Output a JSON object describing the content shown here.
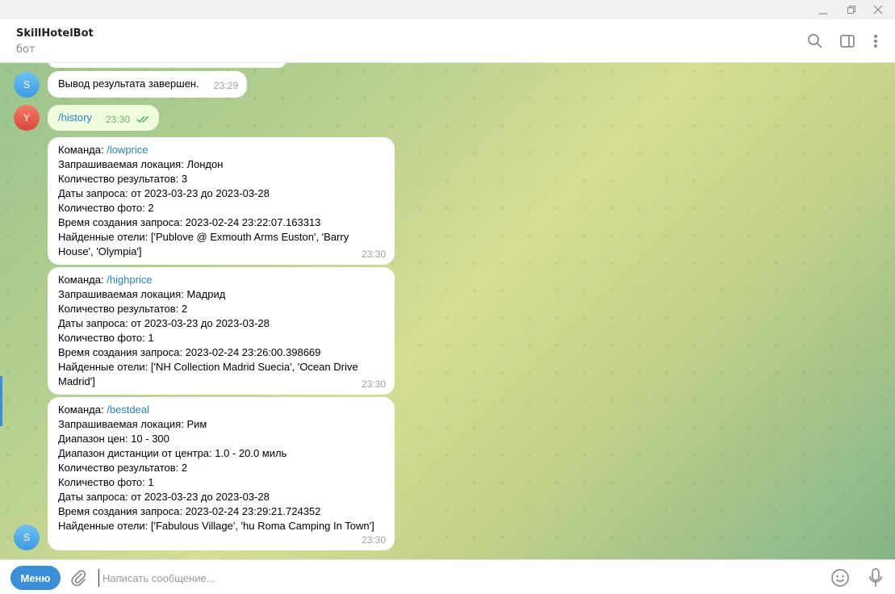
{
  "window": {
    "minimize": "–",
    "maximize": "❐",
    "close": "✕"
  },
  "header": {
    "title": "SkillHotelBot",
    "subtitle": "бот"
  },
  "avatars": {
    "bot": "S",
    "user": "Y"
  },
  "messages": {
    "done": {
      "text": "Вывод результата завершен.",
      "time": "23:29"
    },
    "history": {
      "text": "/history",
      "time": "23:30"
    },
    "m1": {
      "cmd_label": "Команда: ",
      "cmd": "/lowprice",
      "lines": [
        "Запрашиваемая локация: Лондон",
        "Количество результатов: 3",
        "Даты запроса: от 2023-03-23 до 2023-03-28",
        "Количество фото: 2",
        "Время создания запроса: 2023-02-24 23:22:07.163313",
        "Найденные отели: ['Publove @ Exmouth Arms Euston', 'Barry",
        "House', 'Olympia']"
      ],
      "time": "23:30"
    },
    "m2": {
      "cmd_label": "Команда: ",
      "cmd": "/highprice",
      "lines": [
        "Запрашиваемая локация: Мадрид",
        "Количество результатов: 2",
        "Даты запроса: от 2023-03-23 до 2023-03-28",
        "Количество фото: 1",
        "Время создания запроса: 2023-02-24 23:26:00.398669",
        "Найденные отели: ['NH Collection Madrid Suecia', 'Ocean Drive",
        "Madrid']"
      ],
      "time": "23:30"
    },
    "m3": {
      "cmd_label": "Команда: ",
      "cmd": "/bestdeal",
      "lines": [
        "Запрашиваемая локация: Рим",
        "Диапазон цен: 10 - 300",
        "Диапазон дистанции от центра: 1.0 - 20.0 миль",
        "Количество результатов: 2",
        "Количество фото: 1",
        "Даты запроса: от 2023-03-23 до 2023-03-28",
        "Время создания запроса: 2023-02-24 23:29:21.724352",
        "Найденные отели: ['Fabulous Village', 'hu Roma Camping In Town']"
      ],
      "time": "23:30"
    }
  },
  "composer": {
    "menu_label": "Меню",
    "placeholder": "Написать сообщение..."
  },
  "colors": {
    "accent": "#3a8ed8",
    "link": "#2481cc",
    "outgoing": "#effdde"
  }
}
